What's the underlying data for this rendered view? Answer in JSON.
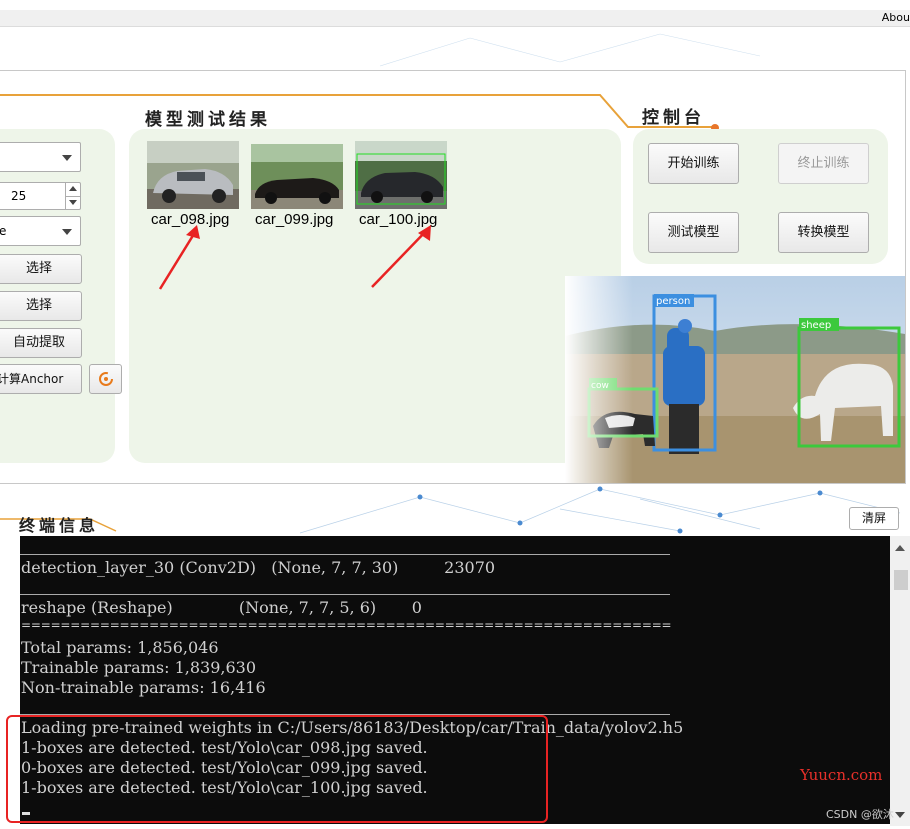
{
  "menubar": {
    "about": "Abou"
  },
  "results": {
    "title": "模型测试结果",
    "images": [
      {
        "filename": "car_098.jpg"
      },
      {
        "filename": "car_099.jpg"
      },
      {
        "filename": "car_100.jpg"
      }
    ]
  },
  "console": {
    "title": "控制台",
    "buttons": {
      "start_train": "开始训练",
      "stop_train": "终止训练",
      "test_model": "测试模型",
      "convert_model": "转换模型"
    }
  },
  "left_panel": {
    "spinner_value": "25",
    "dropdown2_text": "e",
    "select1": "选择",
    "select2": "选择",
    "auto_extract": "自动提取",
    "calc_anchor": "计算Anchor"
  },
  "detection_image": {
    "labels": {
      "person": "person",
      "sheep": "sheep",
      "cow": "cow"
    }
  },
  "terminal_section": {
    "title": "终端信息",
    "clear_button": "清屏",
    "lines": [
      "detection_layer_30 (Conv2D)   (None, 7, 7, 30)         23070",
      "reshape (Reshape)             (None, 7, 7, 5, 6)       0",
      "==================================================================",
      "Total params: 1,856,046",
      "Trainable params: 1,839,630",
      "Non-trainable params: 16,416",
      "Loading pre-trained weights in C:/Users/86183/Desktop/car/Train_data/yolov2.h5",
      "1-boxes are detected. test/Yolo\\car_098.jpg saved.",
      "0-boxes are detected. test/Yolo\\car_099.jpg saved.",
      "1-boxes are detected. test/Yolo\\car_100.jpg saved."
    ]
  },
  "watermarks": {
    "yuucn": "Yuucn.com",
    "csdn": "CSDN @欲沐"
  },
  "colors": {
    "accent_orange": "#e8a23a",
    "card_green": "#eef5e9",
    "annotation_red": "#e82323"
  }
}
